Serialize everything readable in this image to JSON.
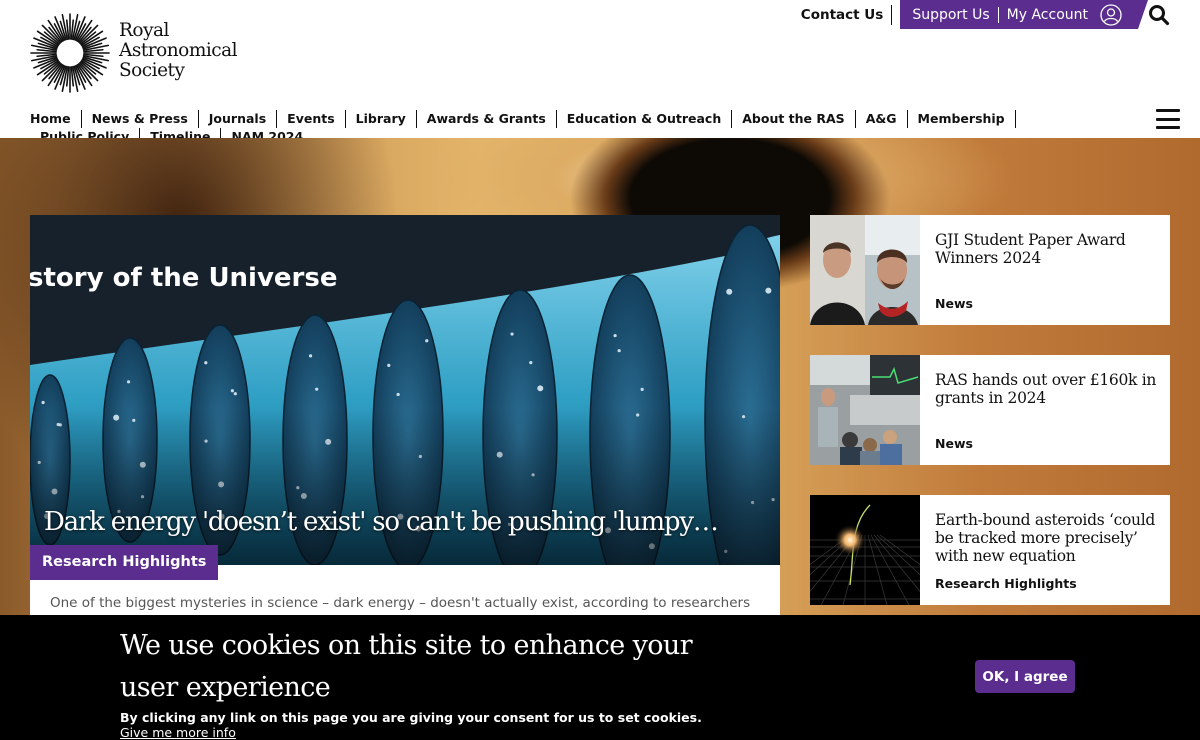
{
  "logo": {
    "line1": "Royal",
    "line2": "Astronomical",
    "line3": "Society"
  },
  "top_links": {
    "contact": "Contact Us",
    "support": "Support Us",
    "account": "My Account"
  },
  "nav": [
    "Home",
    "News & Press",
    "Journals",
    "Events",
    "Library",
    "Awards & Grants",
    "Education & Outreach",
    "About the RAS",
    "A&G",
    "Membership",
    "Public Policy",
    "Timeline",
    "NAM 2024"
  ],
  "feature": {
    "image_text": "story of the Universe",
    "title": "Dark energy 'doesn’t exist' so can't be pushing 'lumpy…",
    "tag": "Research Highlights",
    "description": "One of the biggest mysteries in science – dark energy – doesn't actually exist, according to researchers"
  },
  "cards": [
    {
      "title": "GJI Student Paper Award Winners 2024",
      "tag": "News"
    },
    {
      "title": "RAS hands out over £160k in grants in 2024",
      "tag": "News"
    },
    {
      "title": "Earth-bound asteroids ‘could be tracked more precisely’ with new equation",
      "tag": "Research Highlights"
    }
  ],
  "cookie": {
    "heading": "We use cookies on this site to enhance your user experience",
    "subtext": "By clicking any link on this page you are giving your consent for us to set cookies.",
    "more": "Give me more info",
    "button": "OK, I agree"
  },
  "colors": {
    "brand_purple": "#5b2d8e",
    "banner_bg": "#000000"
  },
  "icons": [
    "sun-logo-icon",
    "account-icon",
    "search-icon",
    "hamburger-menu-icon"
  ]
}
